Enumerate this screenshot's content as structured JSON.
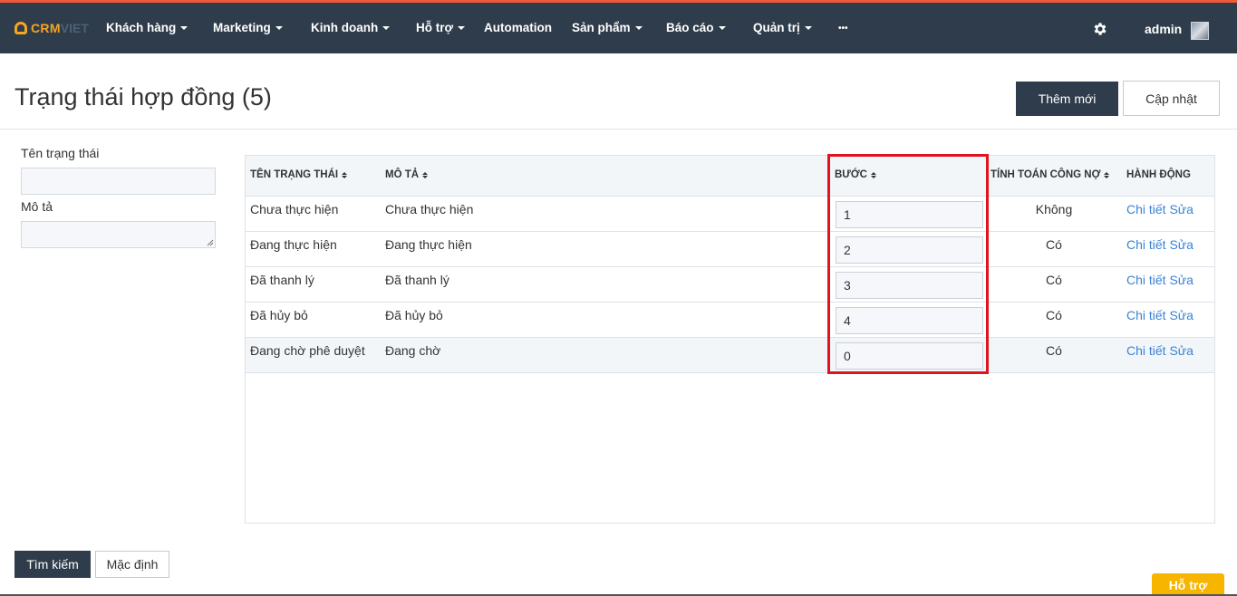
{
  "brand": {
    "logo_primary": "CRM",
    "logo_secondary": "VIET",
    "accent": "#f5a623",
    "nav_bg": "#2f3c4b",
    "top_border": "#f05a38"
  },
  "nav": {
    "items": [
      {
        "label": "Khách hàng",
        "has_caret": true
      },
      {
        "label": "Marketing",
        "has_caret": true
      },
      {
        "label": "Kinh doanh",
        "has_caret": true
      },
      {
        "label": "Hỗ trợ",
        "has_caret": true
      },
      {
        "label": "Automation",
        "has_caret": false
      },
      {
        "label": "Sản phẩm",
        "has_caret": true
      },
      {
        "label": "Báo cáo",
        "has_caret": true
      },
      {
        "label": "Quản trị",
        "has_caret": true
      },
      {
        "label": "•••",
        "has_caret": false
      }
    ],
    "settings_icon": "gear-icon",
    "user": "admin"
  },
  "page": {
    "title": "Trạng thái hợp đồng (5)",
    "add_button": "Thêm mới",
    "update_button": "Cập nhật"
  },
  "filters": {
    "name_label": "Tên trạng thái",
    "name_value": "",
    "desc_label": "Mô tả",
    "desc_value": "",
    "search_button": "Tìm kiếm",
    "default_button": "Mặc định"
  },
  "table": {
    "headers": {
      "name": "TÊN TRẠNG THÁI",
      "desc": "MÔ TẢ",
      "step": "BƯỚC",
      "calc": "TÍNH TOÁN CÔNG NỢ",
      "action": "HÀNH ĐỘNG"
    },
    "rows": [
      {
        "name": "Chưa thực hiện",
        "desc": "Chưa thực hiện",
        "step": "1",
        "calc": "Không",
        "detail": "Chi tiết",
        "edit": "Sửa"
      },
      {
        "name": "Đang thực hiện",
        "desc": "Đang thực hiện",
        "step": "2",
        "calc": "Có",
        "detail": "Chi tiết",
        "edit": "Sửa"
      },
      {
        "name": "Đã thanh lý",
        "desc": "Đã thanh lý",
        "step": "3",
        "calc": "Có",
        "detail": "Chi tiết",
        "edit": "Sửa"
      },
      {
        "name": "Đã hủy bỏ",
        "desc": "Đã hủy bỏ",
        "step": "4",
        "calc": "Có",
        "detail": "Chi tiết",
        "edit": "Sửa"
      },
      {
        "name": "Đang chờ phê duyệt",
        "desc": "Đang chờ",
        "step": "0",
        "calc": "Có",
        "detail": "Chi tiết",
        "edit": "Sửa"
      }
    ]
  },
  "support_button": "Hỗ trợ",
  "colors": {
    "link": "#3a83d4",
    "highlight": "#e0141e",
    "support": "#f7b500"
  }
}
